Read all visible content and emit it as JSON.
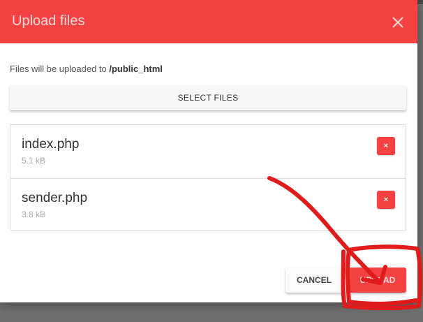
{
  "dialog": {
    "title": "Upload files",
    "destination_prefix": "Files will be uploaded to ",
    "destination_path": "/public_html",
    "select_files_label": "SELECT FILES",
    "cancel_label": "CANCEL",
    "upload_label": "UPLOAD",
    "remove_label": "×"
  },
  "files": [
    {
      "name": "index.php",
      "size": "5.1 kB"
    },
    {
      "name": "sender.php",
      "size": "3.8 kB"
    }
  ],
  "colors": {
    "accent": "#f44242",
    "annotation": "#e01b1b"
  },
  "icons": {
    "close": "close-icon"
  }
}
